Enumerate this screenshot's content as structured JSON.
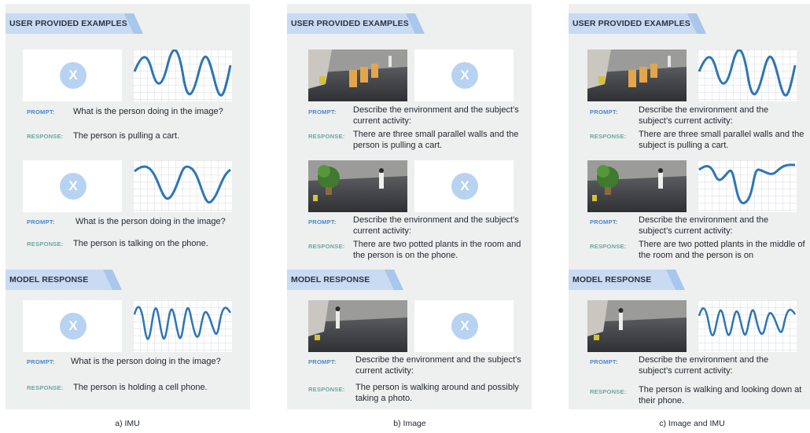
{
  "labels": {
    "user_examples": "USER PROVIDED EXAMPLES",
    "model_response": "MODEL RESPONSE",
    "prompt": "PROMPT:",
    "response": "RESPONSE:",
    "x_mark": "X"
  },
  "panel_a": {
    "caption": "a) IMU",
    "ex1": {
      "prompt": "What is the person doing in the image?",
      "response": "The person is pulling a cart."
    },
    "ex2": {
      "prompt": "What is the person doing in the image?",
      "response": "The person is talking on the phone."
    },
    "model": {
      "prompt": "What is the person doing in the image?",
      "response": "The person is holding a cell phone."
    }
  },
  "panel_b": {
    "caption": "b) Image",
    "ex1": {
      "prompt": "Describe the environment and the subject’s current activity:",
      "response": "There are three small parallel walls and the person is pulling a cart."
    },
    "ex2": {
      "prompt": "Describe the environment and the subject’s current activity:",
      "response": "There are two potted plants in the room and the person is on the phone."
    },
    "model": {
      "prompt": "Describe the environment and the subject’s current activity:",
      "response": "The person is walking around and possibly taking a photo."
    }
  },
  "panel_c": {
    "caption": "c) Image and IMU",
    "ex1": {
      "prompt": "Describe the environment and the subject’s current activity:",
      "response": "There are three small parallel walls and the subject is pulling a cart."
    },
    "ex2": {
      "prompt": "Describe the environment and the subject’s current activity:",
      "response": "There are two potted plants in the middle of the room and the person is on"
    },
    "model": {
      "prompt": "Describe the environment and the subject’s current activity:",
      "response": "The person is walking and looking down at their phone."
    }
  },
  "colors": {
    "panel_bg": "#eef0ef",
    "banner_dark": "#c9daf3",
    "banner_light": "#a9c7ec",
    "prompt_tag": "#4a86cf",
    "response_tag": "#6aa8a3",
    "wave_stroke": "#2e75b6"
  },
  "icons": {
    "missing_modality": "x-circle-icon",
    "imu_signal": "waveform-icon",
    "scene_photo": "room-photo-icon"
  }
}
